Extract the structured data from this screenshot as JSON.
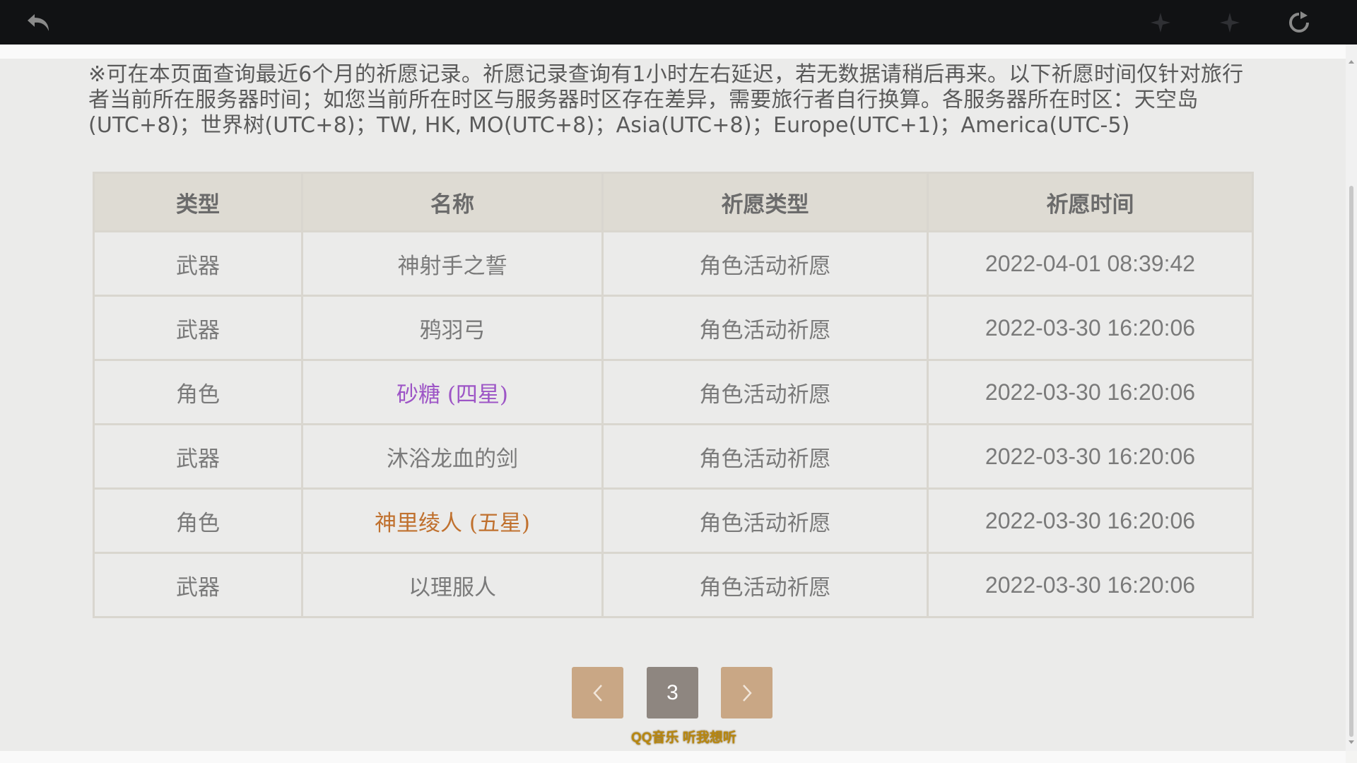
{
  "toolbar": {
    "back_icon": "back-arrow-icon",
    "nav_prev_icon": "diamond-left-icon",
    "nav_next_icon": "diamond-right-icon",
    "refresh_icon": "refresh-icon"
  },
  "notice": "※可在本页面查询最近6个月的祈愿记录。祈愿记录查询有1小时左右延迟，若无数据请稍后再来。以下祈愿时间仅针对旅行者当前所在服务器时间；如您当前所在时区与服务器时区存在差异，需要旅行者自行换算。各服务器所在时区：天空岛(UTC+8)；世界树(UTC+8)；TW, HK, MO(UTC+8)；Asia(UTC+8)；Europe(UTC+1)；America(UTC-5)",
  "table": {
    "headers": [
      "类型",
      "名称",
      "祈愿类型",
      "祈愿时间"
    ],
    "rows": [
      {
        "type": "武器",
        "name": "神射手之誓",
        "wish_type": "角色活动祈愿",
        "time": "2022-04-01 08:39:42",
        "rarity": "3"
      },
      {
        "type": "武器",
        "name": "鸦羽弓",
        "wish_type": "角色活动祈愿",
        "time": "2022-03-30 16:20:06",
        "rarity": "3"
      },
      {
        "type": "角色",
        "name": "砂糖 (四星)",
        "wish_type": "角色活动祈愿",
        "time": "2022-03-30 16:20:06",
        "rarity": "4"
      },
      {
        "type": "武器",
        "name": "沐浴龙血的剑",
        "wish_type": "角色活动祈愿",
        "time": "2022-03-30 16:20:06",
        "rarity": "3"
      },
      {
        "type": "角色",
        "name": "神里绫人 (五星)",
        "wish_type": "角色活动祈愿",
        "time": "2022-03-30 16:20:06",
        "rarity": "5"
      },
      {
        "type": "武器",
        "name": "以理服人",
        "wish_type": "角色活动祈愿",
        "time": "2022-03-30 16:20:06",
        "rarity": "3"
      }
    ],
    "colors": {
      "four_star": "#9d55c6",
      "five_star": "#c0712f"
    }
  },
  "pager": {
    "prev_icon": "chevron-left-icon",
    "current_page": "3",
    "next_icon": "chevron-right-icon"
  },
  "watermark": "QQ音乐 听我想听"
}
